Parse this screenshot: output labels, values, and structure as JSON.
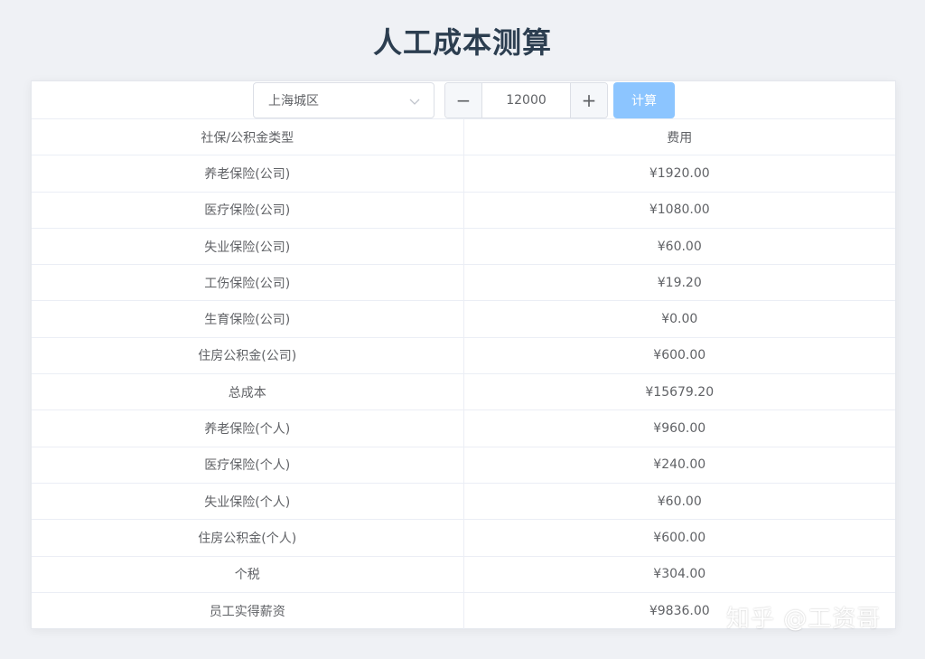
{
  "page": {
    "title": "人工成本测算"
  },
  "toolbar": {
    "region_value": "上海城区",
    "amount_value": "12000",
    "minus_label": "−",
    "plus_label": "+",
    "calc_label": "计算"
  },
  "table": {
    "headers": [
      "社保/公积金类型",
      "费用"
    ],
    "rows": [
      [
        "养老保险(公司)",
        "¥1920.00"
      ],
      [
        "医疗保险(公司)",
        "¥1080.00"
      ],
      [
        "失业保险(公司)",
        "¥60.00"
      ],
      [
        "工伤保险(公司)",
        "¥19.20"
      ],
      [
        "生育保险(公司)",
        "¥0.00"
      ],
      [
        "住房公积金(公司)",
        "¥600.00"
      ],
      [
        "总成本",
        "¥15679.20"
      ],
      [
        "养老保险(个人)",
        "¥960.00"
      ],
      [
        "医疗保险(个人)",
        "¥240.00"
      ],
      [
        "失业保险(个人)",
        "¥60.00"
      ],
      [
        "住房公积金(个人)",
        "¥600.00"
      ],
      [
        "个税",
        "¥304.00"
      ],
      [
        "员工实得薪资",
        "¥9836.00"
      ]
    ]
  },
  "watermark": "知乎 @工资哥",
  "colors": {
    "accent": "#8cc5ff",
    "title": "#2c3e50",
    "text": "#606266",
    "background": "#eff1f5"
  }
}
